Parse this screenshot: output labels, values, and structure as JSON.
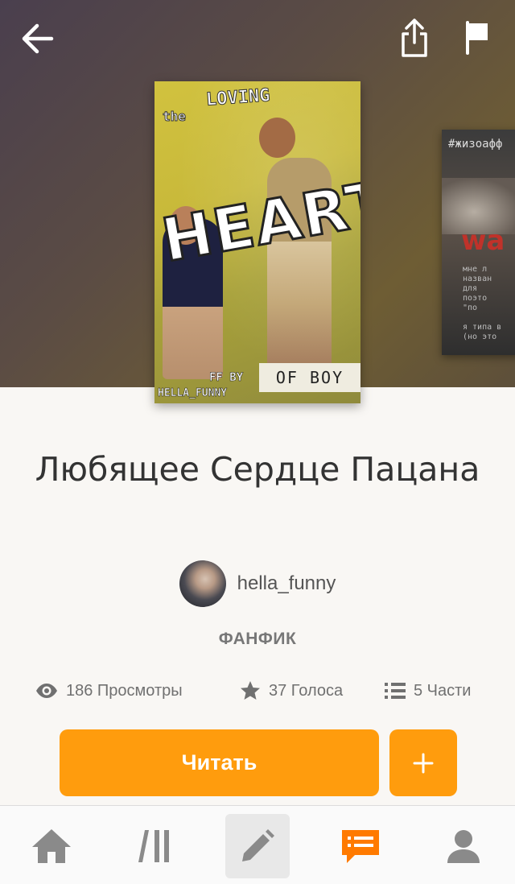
{
  "colors": {
    "accent": "#ff9c0d",
    "hero_bg": "#5b4c44",
    "text_dark": "#333333",
    "text_muted": "#707070",
    "page_bg": "#f9f7f4",
    "tab_active_bg": "#e8e8e8"
  },
  "header": {
    "back_icon": "arrow-left-icon",
    "share_icon": "share-icon",
    "report_icon": "flag-icon"
  },
  "covers": {
    "main": {
      "title_word": "HEART",
      "top_word": "LOVING",
      "the_word": "the",
      "bottom_word": "OF BOY",
      "ff_by": "FF BY",
      "author_tag": "HELLA_FUNNY"
    },
    "side": {
      "tag": "#жизоафф",
      "big_word": "wa",
      "lines": "мне л\nназван\nдля \nпоэто\n\"по\n\nя типа в\n(но это"
    }
  },
  "story": {
    "title": "Любящее Сердце Пацана",
    "author": "hella_funny",
    "category": "ФАНФИК",
    "stats": {
      "views": "186 Просмотры",
      "votes": "37 Голоса",
      "parts": "5 Части"
    }
  },
  "actions": {
    "read_label": "Читать",
    "add_label": "+"
  },
  "tabbar": {
    "items": [
      {
        "name": "home",
        "icon": "home-icon",
        "active": false
      },
      {
        "name": "library",
        "icon": "library-icon",
        "active": false
      },
      {
        "name": "write",
        "icon": "pencil-icon",
        "active": true
      },
      {
        "name": "messages",
        "icon": "messages-icon",
        "active": false
      },
      {
        "name": "profile",
        "icon": "profile-icon",
        "active": false
      }
    ]
  }
}
